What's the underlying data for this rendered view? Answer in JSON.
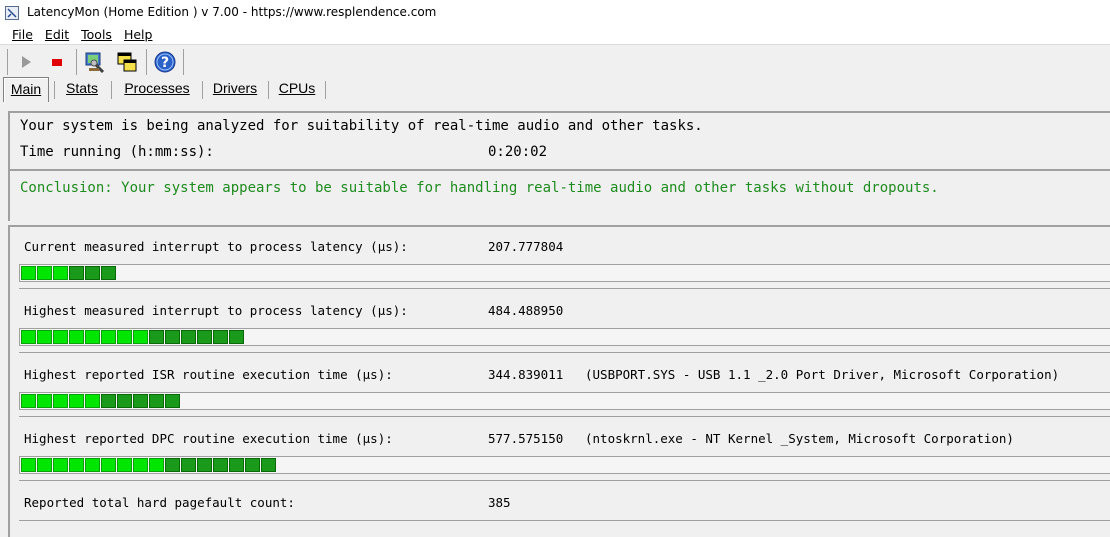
{
  "window": {
    "title": "LatencyMon  (Home Edition )  v 7.00 - https://www.resplendence.com"
  },
  "menu": {
    "items": [
      {
        "label": "File"
      },
      {
        "label": "Edit"
      },
      {
        "label": "Tools"
      },
      {
        "label": "Help"
      }
    ]
  },
  "toolbar": {
    "icons": [
      "play-icon",
      "stop-icon",
      "tools-icon",
      "windows-icon",
      "help-icon"
    ]
  },
  "tabs": [
    {
      "label": "Main",
      "active": true
    },
    {
      "label": "Stats"
    },
    {
      "label": "Processes"
    },
    {
      "label": "Drivers"
    },
    {
      "label": "CPUs"
    }
  ],
  "status": {
    "analyzing": "Your system is being analyzed for suitability of real-time audio and other tasks.",
    "time_label": "Time running (h:mm:ss):",
    "time_value": "0:20:02",
    "conclusion": "Conclusion: Your system appears to be suitable for handling real-time audio and other tasks without dropouts."
  },
  "metrics": [
    {
      "label": "Current measured interrupt to process latency (µs):",
      "value": "207.777804",
      "extra": "",
      "segments": 6
    },
    {
      "label": "Highest measured interrupt to process latency (µs):",
      "value": "484.488950",
      "extra": "",
      "segments": 14
    },
    {
      "label": "Highest reported ISR routine execution time (µs):",
      "value": "344.839011",
      "extra": "(USBPORT.SYS - USB 1.1 _2.0 Port Driver, Microsoft Corporation)",
      "segments": 10
    },
    {
      "label": "Highest reported DPC routine execution time (µs):",
      "value": "577.575150",
      "extra": "(ntoskrnl.exe - NT Kernel _System, Microsoft Corporation)",
      "segments": 16
    },
    {
      "label": "Reported total hard pagefault count:",
      "value": "385",
      "extra": "",
      "segments": 0
    }
  ],
  "colors": {
    "bar_bright": "#00e600",
    "bar_dark": "#1a9a1a",
    "conclusion": "#1e8c1e"
  }
}
